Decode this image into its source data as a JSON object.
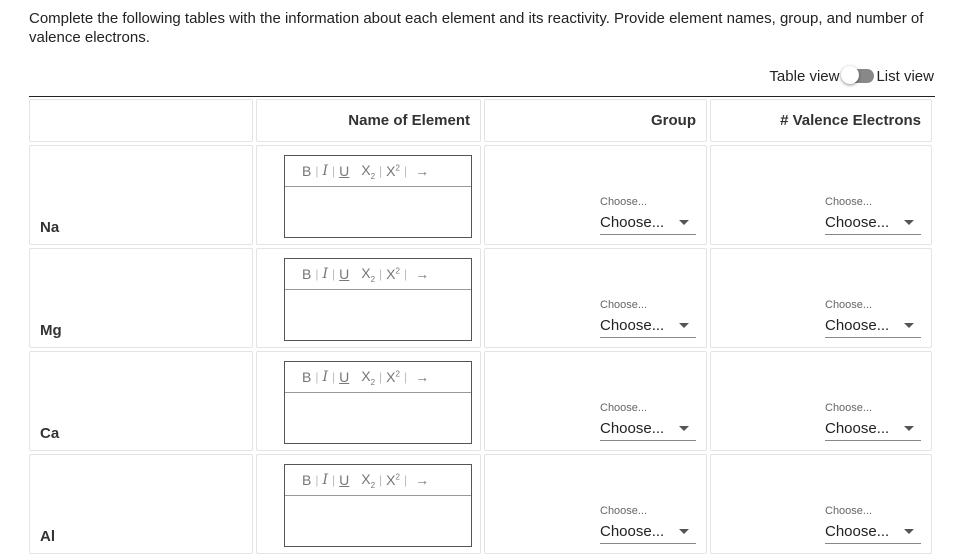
{
  "instructions": "Complete the following tables with the information about each element and its reactivity. Provide element names, group, and number of valence electrons.",
  "view_toggle": {
    "left_label": "Table view",
    "right_label": "List view"
  },
  "headers": [
    "",
    "Name of Element",
    "Group",
    "# Valence Electrons"
  ],
  "toolbar": {
    "bold": "B",
    "italic": "I",
    "underline": "U",
    "subscript": "X",
    "sub_mark": "2",
    "superscript": "X",
    "sup_mark": "2",
    "arrow": "→"
  },
  "rows": [
    {
      "element": "Na",
      "group_label": "Choose...",
      "group_value": "Choose...",
      "valence_label": "Choose...",
      "valence_value": "Choose..."
    },
    {
      "element": "Mg",
      "group_label": "Choose...",
      "group_value": "Choose...",
      "valence_label": "Choose...",
      "valence_value": "Choose..."
    },
    {
      "element": "Ca",
      "group_label": "Choose...",
      "group_value": "Choose...",
      "valence_label": "Choose...",
      "valence_value": "Choose..."
    },
    {
      "element": "Al",
      "group_label": "Choose...",
      "group_value": "Choose...",
      "valence_label": "Choose...",
      "valence_value": "Choose..."
    }
  ]
}
